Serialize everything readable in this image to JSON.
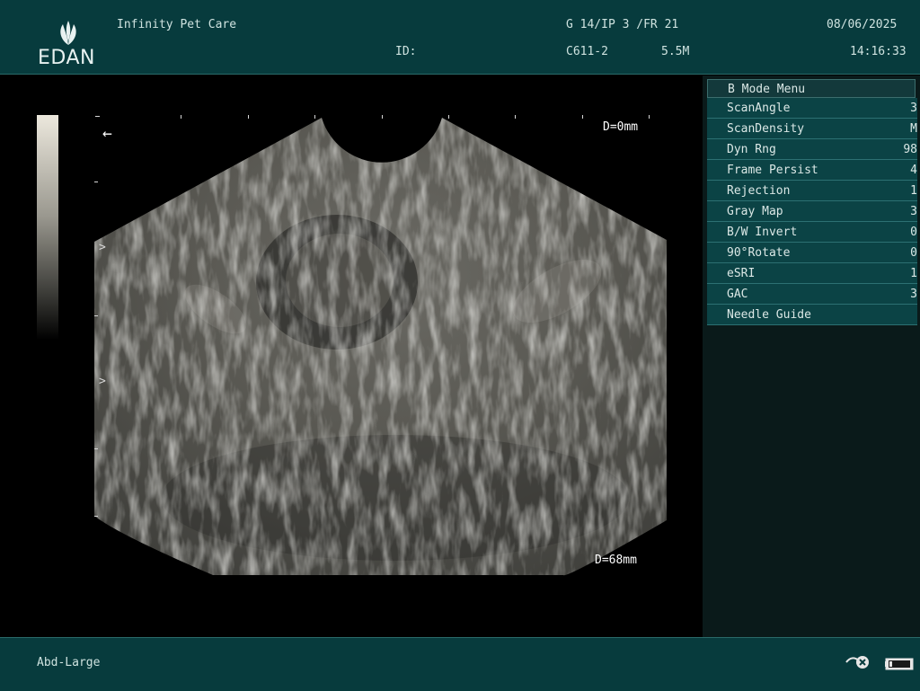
{
  "header": {
    "logo": {
      "brand": "EDAN"
    },
    "clinic": "Infinity Pet Care",
    "id_label": "ID:",
    "gain_line": "G 14/IP 3 /FR 21",
    "probe_model": "C611-2",
    "frequency": "5.5M",
    "date": "08/06/2025",
    "time": "14:16:33"
  },
  "image": {
    "depth_top": "D=0mm",
    "depth_bottom": "D=68mm",
    "focus_marker": ">"
  },
  "menu": {
    "title": "B Mode Menu",
    "items": [
      {
        "label": "ScanAngle",
        "value": "3"
      },
      {
        "label": "ScanDensity",
        "value": "M"
      },
      {
        "label": "Dyn Rng",
        "value": "98"
      },
      {
        "label": "Frame Persist",
        "value": "4"
      },
      {
        "label": "Rejection",
        "value": "1"
      },
      {
        "label": "Gray Map",
        "value": "3"
      },
      {
        "label": "B/W Invert",
        "value": "0"
      },
      {
        "label": "90°Rotate",
        "value": "0"
      },
      {
        "label": "eSRI",
        "value": "1"
      },
      {
        "label": "GAC",
        "value": "3"
      },
      {
        "label": "Needle Guide",
        "value": ""
      }
    ]
  },
  "footer": {
    "exam_preset": "Abd-Large",
    "icons": [
      "probe-connection-icon",
      "battery-icon"
    ]
  },
  "colors": {
    "panel_teal": "#073b3d",
    "menu_item": "#0b4345",
    "text": "#cfe3e0"
  }
}
